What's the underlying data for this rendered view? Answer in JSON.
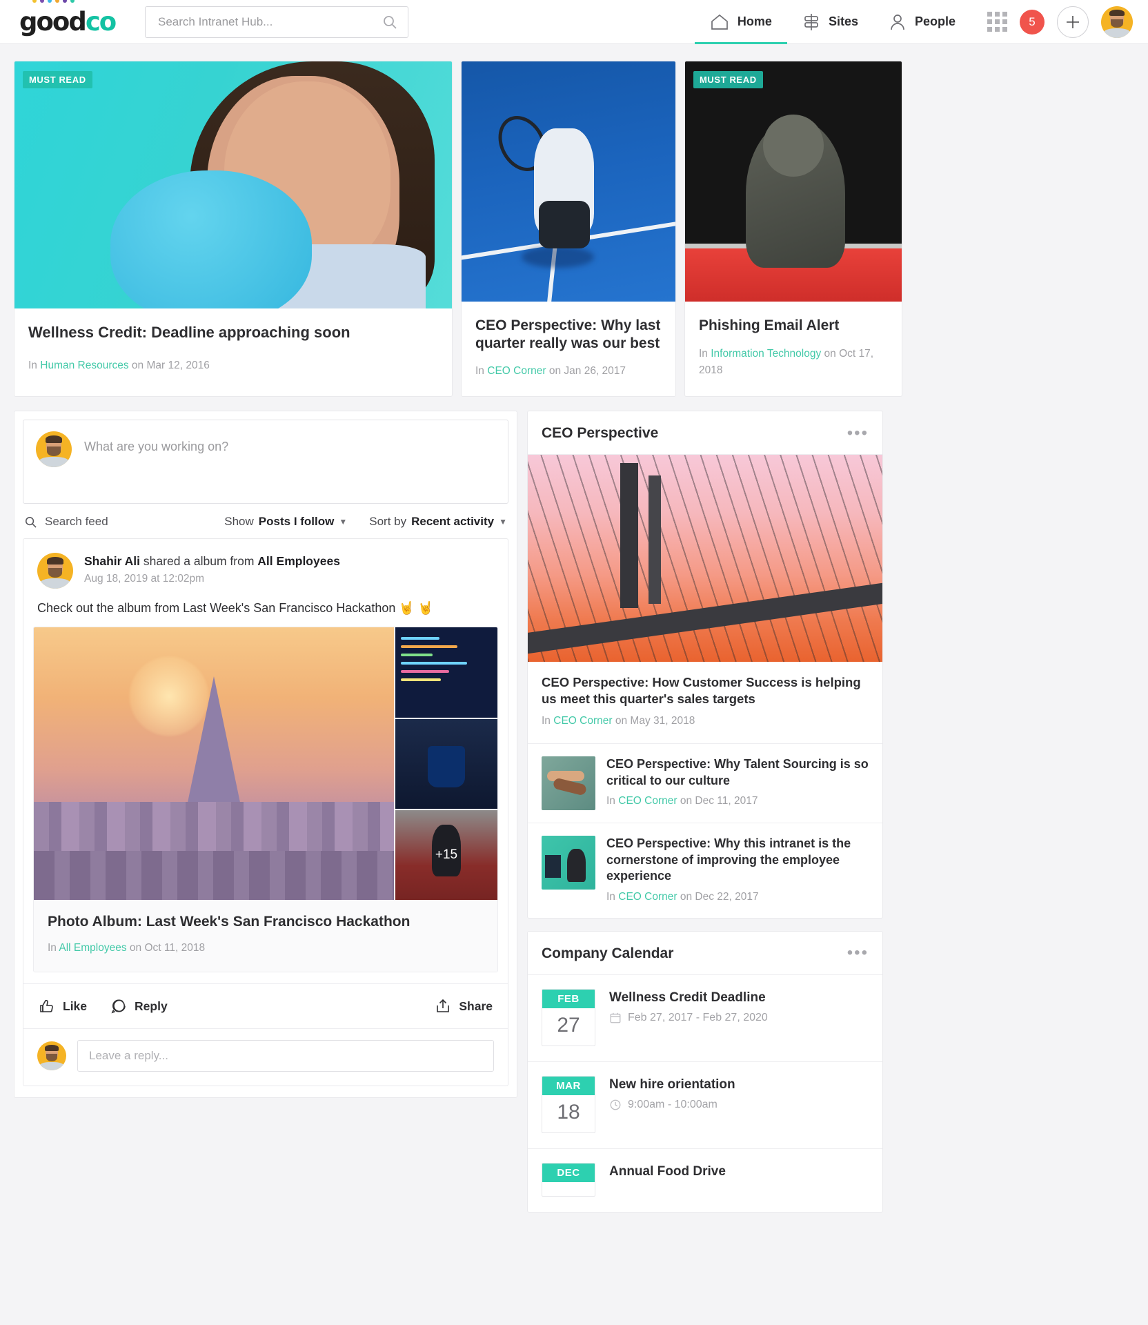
{
  "brand": {
    "name_dark": "good",
    "name_teal": "co",
    "accent": "#14c2a3",
    "dot_colors": [
      "#f2c230",
      "#7a4fb0",
      "#3fb9e8",
      "#f0a830",
      "#6b46a8",
      "#2ec9a8"
    ]
  },
  "search": {
    "placeholder": "Search Intranet Hub...",
    "value": "",
    "icon": "search-icon"
  },
  "nav": {
    "items": [
      {
        "label": "Home",
        "icon": "home-icon",
        "active": true
      },
      {
        "label": "Sites",
        "icon": "signpost-icon",
        "active": false
      },
      {
        "label": "People",
        "icon": "person-icon",
        "active": false
      }
    ],
    "apps_icon": "grid-apps-icon",
    "notification_count": "5",
    "create_label": "+",
    "avatar": "user-avatar"
  },
  "featured": {
    "cards": [
      {
        "badge": "MUST READ",
        "title": "Wellness Credit: Deadline approaching soon",
        "meta_prefix": "In",
        "site": "Human Resources",
        "meta_mid": "on",
        "date": "Mar 12, 2016",
        "image": "woman-holding-blue-piggy-bank"
      },
      {
        "badge": "",
        "title": "CEO Perspective: Why last quarter really was our best",
        "meta_prefix": "In",
        "site": "CEO Corner",
        "meta_mid": "on",
        "date": "Jan 26, 2017",
        "image": "tennis-player-on-blue-court"
      },
      {
        "badge": "MUST READ",
        "title": "Phishing Email Alert",
        "meta_prefix": "In",
        "site": "Information Technology",
        "meta_mid": "on",
        "date": "Oct 17, 2018",
        "image": "hooded-person-with-phone"
      }
    ]
  },
  "composer": {
    "placeholder": "What are you working on?",
    "value": "",
    "avatar": "user-avatar"
  },
  "feedbar": {
    "search_label": "Search feed",
    "search_icon": "search-icon",
    "show_label": "Show",
    "show_value": "Posts I follow",
    "sort_label": "Sort by",
    "sort_value": "Recent activity"
  },
  "post": {
    "author": "Shahir Ali",
    "action": "shared a album from",
    "group": "All Employees",
    "timestamp": "Aug 18, 2019 at 12:02pm",
    "body": "Check out the album from Last Week's San Francisco Hackathon 🤘 🤘",
    "album": {
      "more_count": "+15",
      "title": "Photo Album: Last Week's San Francisco Hackathon",
      "meta_prefix": "In",
      "site": "All Employees",
      "meta_mid": "on",
      "date": "Oct 11, 2018",
      "thumbnails": [
        "san-francisco-skyline",
        "code-editor-screen",
        "coffee-cup",
        "gym-person"
      ]
    },
    "actions": {
      "like": "Like",
      "like_icon": "thumbs-up-icon",
      "reply": "Reply",
      "reply_icon": "comment-bubble-icon",
      "share": "Share",
      "share_icon": "share-icon"
    },
    "reply_placeholder": "Leave a reply...",
    "reply_value": ""
  },
  "ceo_widget": {
    "title": "CEO Perspective",
    "menu_icon": "more-options-icon",
    "hero_image": "suspension-bridge-at-sunset",
    "feature": {
      "title": "CEO Perspective: How Customer Success is helping us meet this quarter's sales targets",
      "meta_prefix": "In",
      "site": "CEO Corner",
      "meta_mid": "on",
      "date": "May 31, 2018"
    },
    "items": [
      {
        "title": "CEO Perspective: Why Talent Sourcing is so critical to our culture",
        "meta_prefix": "In",
        "site": "CEO Corner",
        "meta_mid": "on",
        "date": "Dec 11, 2017",
        "thumb": "hands-together-teamwork"
      },
      {
        "title": "CEO Perspective: Why this intranet is the cornerstone of improving the employee experience",
        "meta_prefix": "In",
        "site": "CEO Corner",
        "meta_mid": "on",
        "date": "Dec 22, 2017",
        "thumb": "woman-at-desk"
      }
    ]
  },
  "calendar_widget": {
    "title": "Company Calendar",
    "menu_icon": "more-options-icon",
    "events": [
      {
        "month": "FEB",
        "day": "27",
        "title": "Wellness Credit Deadline",
        "detail": "Feb 27, 2017 - Feb 27, 2020",
        "icon": "calendar-icon"
      },
      {
        "month": "MAR",
        "day": "18",
        "title": "New hire orientation",
        "detail": "9:00am  - 10:00am",
        "icon": "clock-icon"
      },
      {
        "month": "DEC",
        "day": "",
        "title": "Annual Food Drive",
        "detail": "",
        "icon": "calendar-icon"
      }
    ]
  }
}
